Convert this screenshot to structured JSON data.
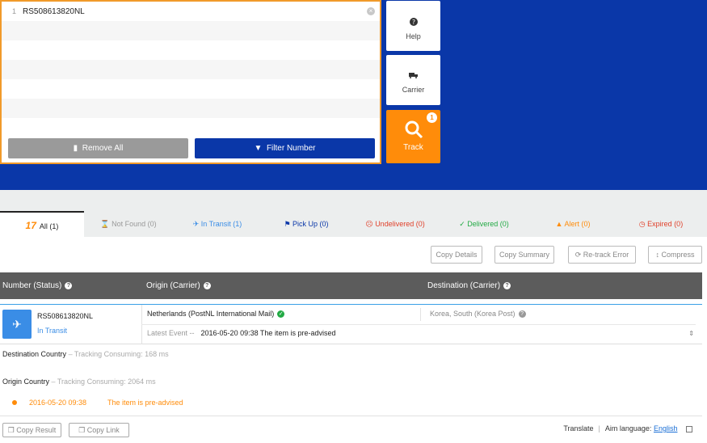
{
  "input": {
    "lines": [
      {
        "num": "1",
        "value": "RS508613820NL"
      },
      {
        "num": "",
        "value": ""
      },
      {
        "num": "",
        "value": ""
      },
      {
        "num": "",
        "value": ""
      },
      {
        "num": "",
        "value": ""
      },
      {
        "num": "",
        "value": ""
      },
      {
        "num": "",
        "value": ""
      }
    ],
    "remove_all_label": "Remove All",
    "filter_label": "Filter Number"
  },
  "side": {
    "help_label": "Help",
    "carrier_label": "Carrier",
    "track_label": "Track",
    "track_badge": "1"
  },
  "tabs": [
    {
      "label": "All (1)",
      "color": "#222222"
    },
    {
      "label": "Not Found (0)",
      "color": "#999999",
      "icon": "hourglass-icon"
    },
    {
      "label": "In Transit (1)",
      "color": "#3a8de6",
      "icon": "plane-icon"
    },
    {
      "label": "Pick Up (0)",
      "color": "#0a37a8",
      "icon": "flag-icon"
    },
    {
      "label": "Undelivered (0)",
      "color": "#e0402a",
      "icon": "sad-face-icon"
    },
    {
      "label": "Delivered (0)",
      "color": "#22aa44",
      "icon": "check-icon"
    },
    {
      "label": "Alert (0)",
      "color": "#ff8c0a",
      "icon": "warning-icon"
    },
    {
      "label": "Expired (0)",
      "color": "#e0402a",
      "icon": "clock-icon"
    }
  ],
  "actions": {
    "copy_details": "Copy Details",
    "copy_summary": "Copy Summary",
    "retrack_error": "Re-track Error",
    "compress": "Compress"
  },
  "table": {
    "col_number": "Number (Status)",
    "col_origin": "Origin (Carrier)",
    "col_destination": "Destination (Carrier)"
  },
  "result": {
    "number": "RS508613820NL",
    "status": "In Transit",
    "origin": "Netherlands  (PostNL International Mail)",
    "destination": "Korea, South  (Korea Post)",
    "latest_event_label": "Latest Event  --",
    "latest_event": "2016-05-20 09:38 The item is pre-advised"
  },
  "details": {
    "dest_country_label": "Destination Country",
    "dest_consuming": "– Tracking Consuming: 168 ms",
    "origin_country_label": "Origin Country",
    "origin_consuming": "– Tracking Consuming: 2064 ms",
    "event_time": "2016-05-20 09:38",
    "event_text": "The item is pre-advised"
  },
  "footer": {
    "copy_result": "Copy Result",
    "copy_link": "Copy Link",
    "translate": "Translate",
    "aim_language_label": "Aim language:",
    "aim_language_value": "English"
  },
  "colors": {
    "brand_blue": "#0a37a8",
    "accent_orange": "#ff8c0a",
    "transit_blue": "#3a8de6"
  }
}
